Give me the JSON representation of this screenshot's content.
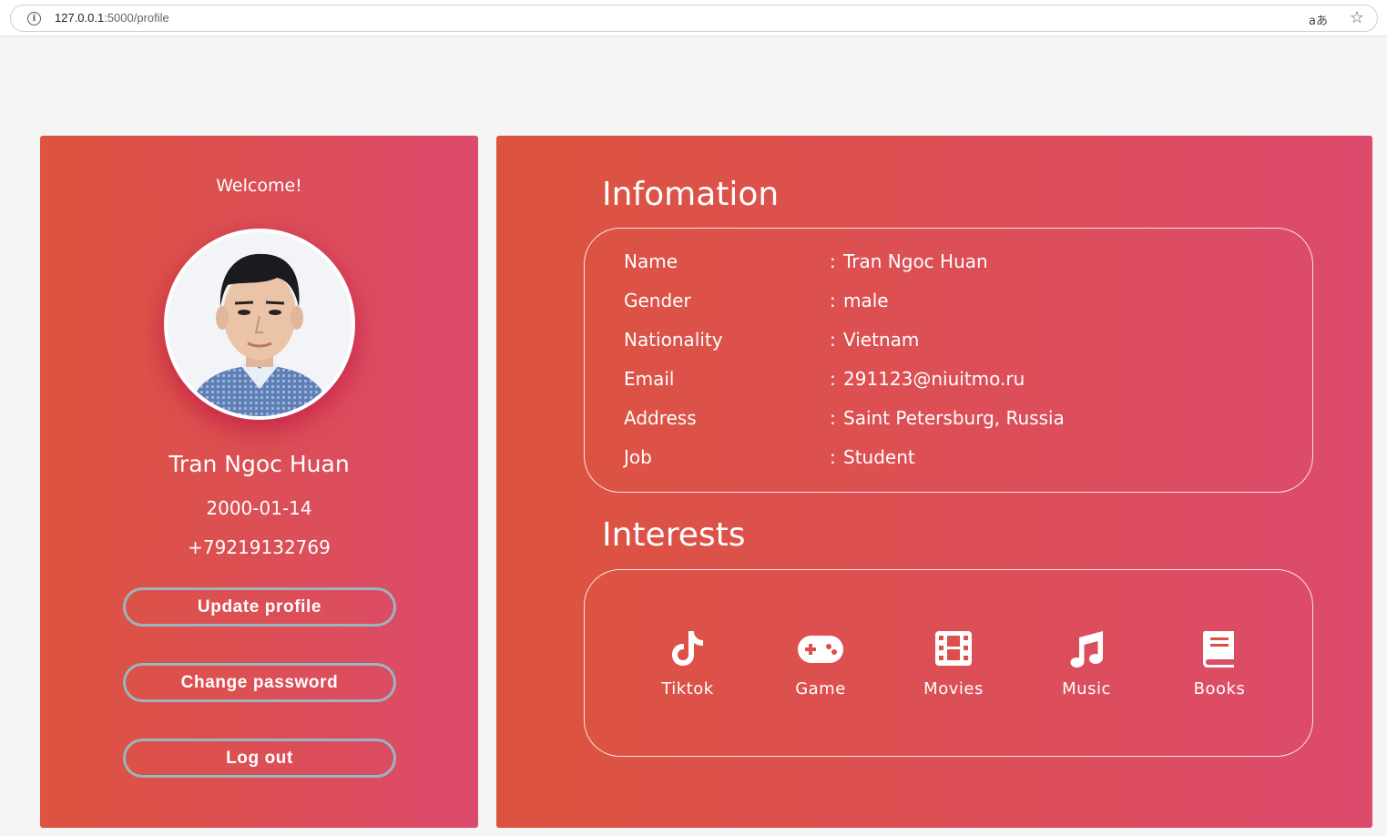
{
  "browser": {
    "url_host": "127.0.0.1",
    "url_path": ":5000/profile",
    "translate_glyph": "aあ",
    "star_glyph": "☆",
    "info_glyph": "i"
  },
  "profile": {
    "welcome": "Welcome!",
    "name": "Tran Ngoc Huan",
    "dob": "2000-01-14",
    "phone": "+79219132769",
    "avatar_icon": "person-photo-icon"
  },
  "buttons": {
    "update": "Update profile",
    "password": "Change password",
    "logout": "Log out"
  },
  "info": {
    "title": "Infomation",
    "rows": [
      {
        "label": "Name",
        "value": "Tran Ngoc Huan"
      },
      {
        "label": "Gender",
        "value": "male"
      },
      {
        "label": "Nationality",
        "value": "Vietnam"
      },
      {
        "label": "Email",
        "value": "291123@niuitmo.ru"
      },
      {
        "label": "Address",
        "value": "Saint Petersburg, Russia"
      },
      {
        "label": "Job",
        "value": "Student"
      }
    ],
    "separator": ":"
  },
  "interests": {
    "title": "Interests",
    "items": [
      {
        "label": "Tiktok",
        "icon": "tiktok-icon"
      },
      {
        "label": "Game",
        "icon": "gamepad-icon"
      },
      {
        "label": "Movies",
        "icon": "film-icon"
      },
      {
        "label": "Music",
        "icon": "music-note-icon"
      },
      {
        "label": "Books",
        "icon": "book-icon"
      }
    ]
  },
  "colors": {
    "gradient_start": "#dc543e",
    "gradient_end": "#dc4a6c",
    "button_border": "#9ab5bf",
    "page_bg": "#f5f5f5"
  }
}
